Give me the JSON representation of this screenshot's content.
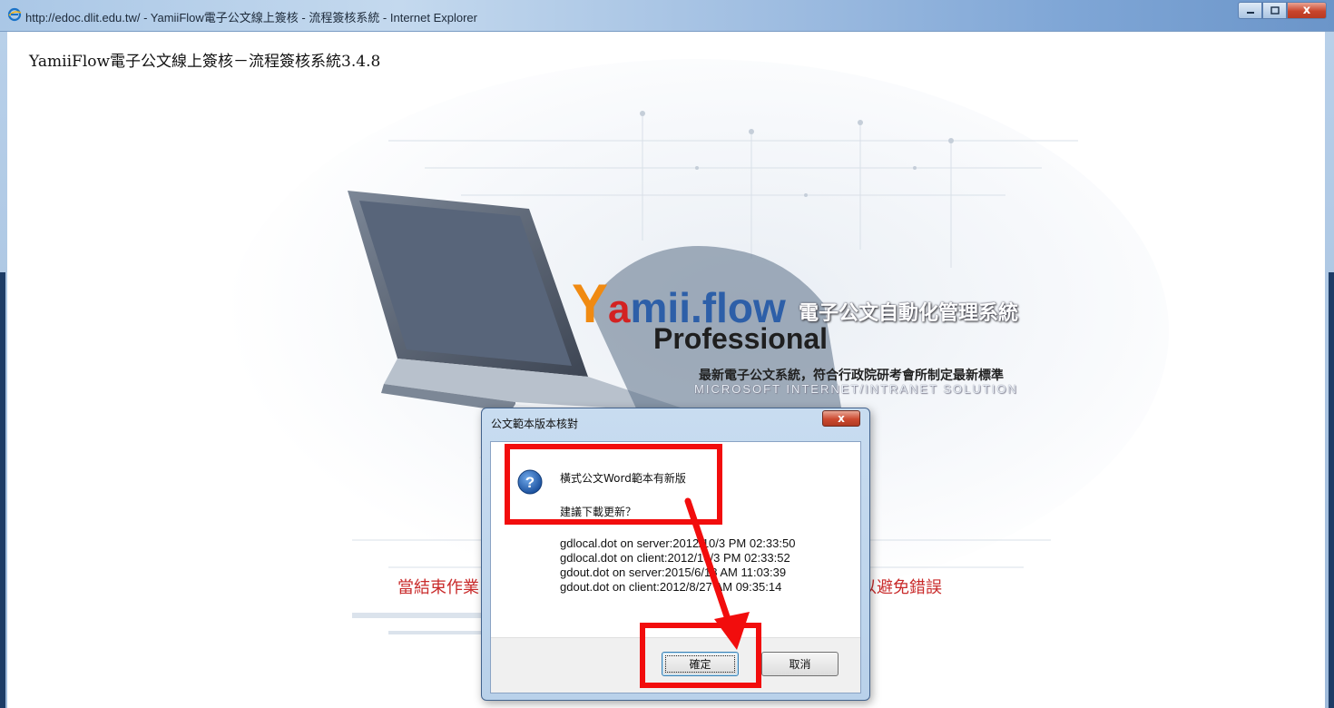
{
  "window": {
    "title": "http://edoc.dlit.edu.tw/ - YamiiFlow電子公文線上簽核 - 流程簽核系統 - Internet Explorer",
    "minimize_icon": "minimize-icon",
    "maximize_icon": "maximize-icon",
    "close_icon": "close-icon",
    "close_label": "x"
  },
  "page": {
    "title": "YamiiFlow電子公文線上簽核－流程簽核系統3.4.8",
    "logo": {
      "word_y": "Y",
      "word_a": "a",
      "word_rest": "mii.flow",
      "cn": "電子公文自動化管理系統",
      "pro": "Professional",
      "tagline": "最新電子公文系統，符合行政院研考會所制定最新標準",
      "sub": "MICROSOFT INTERNET/INTRANET SOLUTION"
    },
    "notice_left": "當結束作業",
    "notice_right": "以避免錯誤"
  },
  "dialog": {
    "title": "公文範本版本核對",
    "close_label": "x",
    "icon": "question-icon",
    "message_line1": "橫式公文Word範本有新版",
    "message_line2": "建議下載更新？",
    "details": [
      "gdlocal.dot on server:2012/10/3 PM 02:33:50",
      "gdlocal.dot on client:2012/10/3 PM 02:33:52",
      "gdout.dot on server:2015/6/18 AM 11:03:39",
      "gdout.dot on client:2012/8/27 AM 09:35:14"
    ],
    "ok_label": "確定",
    "cancel_label": "取消"
  },
  "colors": {
    "highlight": "#f20d0d",
    "notice_text": "#c92b2b",
    "logo_orange": "#f08a12",
    "logo_blue": "#2d5fa8"
  }
}
